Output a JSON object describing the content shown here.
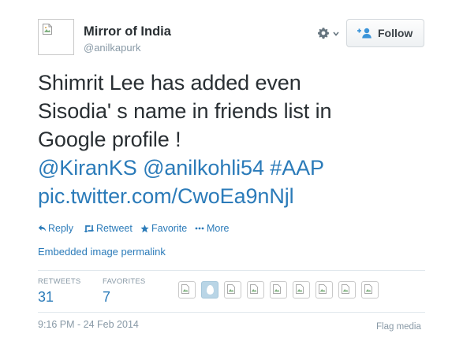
{
  "user": {
    "name": "Mirror of India",
    "screen_name": "@anilkapurk",
    "avatar_icon": "broken-image-icon"
  },
  "header": {
    "settings_icon": "gear-icon",
    "follow_label": "Follow",
    "follow_icon": "add-user-icon"
  },
  "tweet": {
    "lines": [
      "Shimrit Lee has added even",
      "Sisodia' s name in friends list in",
      "Google profile !"
    ],
    "mentions": [
      "@KiranKS",
      "@anilkohli54"
    ],
    "hashtag": "#AAP",
    "media_link": "pic.twitter.com/CwoEa9nNjl"
  },
  "actions": {
    "reply": "Reply",
    "retweet": "Retweet",
    "favorite": "Favorite",
    "more": "More"
  },
  "permalink": "Embedded image permalink",
  "stats": {
    "retweets_label": "RETWEETS",
    "retweets_value": "31",
    "favorites_label": "FAVORITES",
    "favorites_value": "7",
    "favoriter_avatars": [
      "broken",
      "egg",
      "broken",
      "broken",
      "broken",
      "broken",
      "broken",
      "broken",
      "broken"
    ]
  },
  "footer": {
    "timestamp": "9:16 PM - 24 Feb 2014",
    "flag_media": "Flag media"
  },
  "colors": {
    "link": "#2b7bb9",
    "text": "#292f33",
    "muted": "#8899a6",
    "divider": "#e1e8ed"
  }
}
